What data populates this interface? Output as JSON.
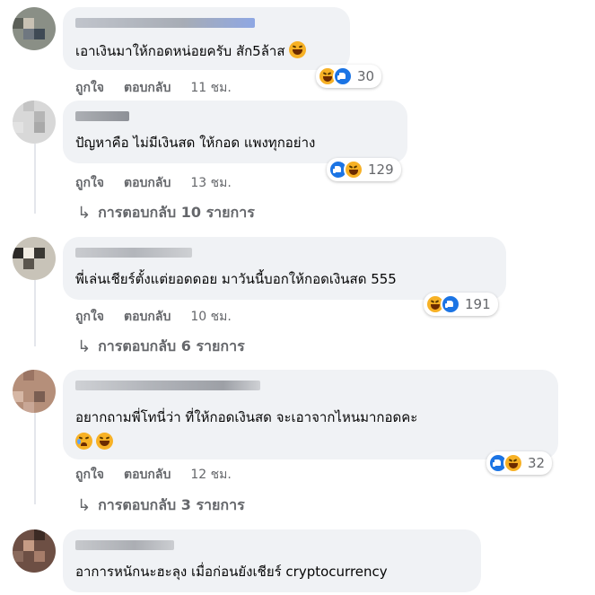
{
  "colors": {
    "bubble": "#f0f2f5",
    "meta_text": "#65676b",
    "like_blue": "#1b74e4",
    "haha_yellow": "#f7b125"
  },
  "actions": {
    "like_label": "ถูกใจ",
    "reply_label": "ตอบกลับ"
  },
  "comments": [
    {
      "text": "เอาเงินมาให้กอดหน่อยครับ สัก5ล้าส",
      "emoji": "laughing-tears-icon",
      "time": "11 ชม.",
      "reactions": [
        "haha-icon",
        "like-icon"
      ],
      "reaction_count": "30"
    },
    {
      "text": "ปัญหาคือ ไม่มีเงินสด ให้กอด แพงทุกอย่าง",
      "time": "13 ชม.",
      "reactions": [
        "like-icon",
        "haha-icon"
      ],
      "reaction_count": "129",
      "replies": "การตอบกลับ 10 รายการ"
    },
    {
      "text": "พี่เล่นเชียร์ตั้งแต่ยอดดอย มาวันนี้บอกให้กอดเงินสด 555",
      "time": "10 ชม.",
      "reactions": [
        "haha-icon",
        "like-icon"
      ],
      "reaction_count": "191",
      "replies": "การตอบกลับ 6 รายการ"
    },
    {
      "text": "อยากถามพี่โทนี่ว่า ที่ให้กอดเงินสด จะเอาจากไหนมากอดคะ",
      "emoji_line": [
        "sad-sweat-icon",
        "laughing-tears-icon"
      ],
      "time": "12 ชม.",
      "reactions": [
        "like-icon",
        "haha-icon"
      ],
      "reaction_count": "32",
      "replies": "การตอบกลับ 3 รายการ"
    },
    {
      "text": "อาการหนักนะฮะลุง เมื่อก่อนยังเชียร์ cryptocurrency"
    }
  ]
}
